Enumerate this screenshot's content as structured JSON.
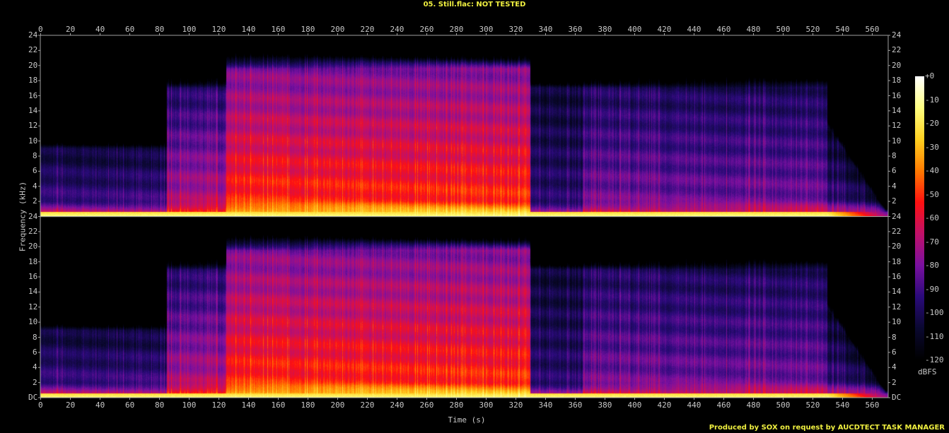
{
  "title": "05. Still.flac: NOT TESTED",
  "footer": "Produced by SOX on request by AUCDTECT TASK MANAGER",
  "chart_data": {
    "type": "heatmap",
    "title": "05. Still.flac: NOT TESTED",
    "xlabel": "Time (s)",
    "ylabel": "Frequency (kHz)",
    "xlim": [
      0,
      571
    ],
    "ylim": [
      0,
      24
    ],
    "channels": 2,
    "x_ticks": [
      "0",
      "20",
      "40",
      "60",
      "80",
      "100",
      "120",
      "140",
      "160",
      "180",
      "200",
      "220",
      "240",
      "260",
      "280",
      "300",
      "320",
      "340",
      "360",
      "380",
      "400",
      "420",
      "440",
      "460",
      "480",
      "500",
      "520",
      "540",
      "560"
    ],
    "y_ticks_upper": [
      "24",
      "22",
      "20",
      "18",
      "16",
      "14",
      "12",
      "10",
      "8",
      "6",
      "4",
      "2"
    ],
    "y_ticks_lower": [
      "24",
      "22",
      "20",
      "18",
      "16",
      "14",
      "12",
      "10",
      "8",
      "6",
      "4",
      "2",
      "DC"
    ],
    "colorbar": {
      "label": "dBFS",
      "range": [
        -120,
        0
      ],
      "ticks": [
        "+0",
        "-10",
        "-20",
        "-30",
        "-40",
        "-50",
        "-60",
        "-70",
        "-80",
        "-90",
        "-100",
        "-110",
        "-120"
      ]
    },
    "segments": [
      {
        "start": 0,
        "end": 85,
        "max_khz": 9,
        "level_db": -88,
        "slope_db": 18
      },
      {
        "start": 85,
        "end": 125,
        "max_khz": 17,
        "level_db": -68,
        "slope_db": 30
      },
      {
        "start": 125,
        "end": 330,
        "max_khz": 19.5,
        "level_db": -48,
        "slope_db": 32
      },
      {
        "start": 330,
        "end": 365,
        "max_khz": 17,
        "level_db": -95,
        "slope_db": 12
      },
      {
        "start": 365,
        "end": 530,
        "max_khz": 17,
        "level_db": -80,
        "slope_db": 20
      },
      {
        "start": 530,
        "end": 571,
        "max_khz": 12,
        "level_db": -92,
        "slope_db": 20
      }
    ],
    "palette": [
      "#000000",
      "#0a0830",
      "#2a0a7a",
      "#7a10a0",
      "#c0106a",
      "#ff1010",
      "#ff7a00",
      "#ffd020",
      "#ffff80",
      "#ffffff"
    ]
  }
}
